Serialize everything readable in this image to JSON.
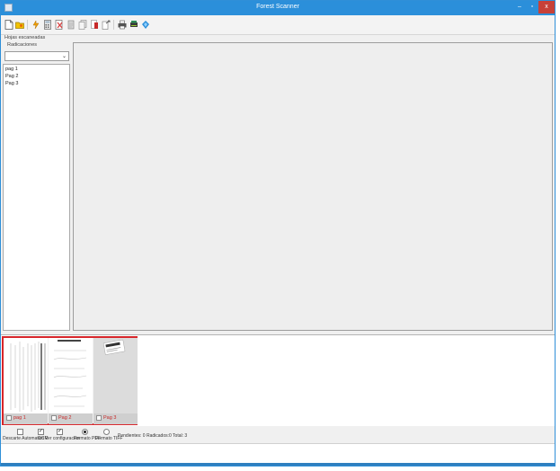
{
  "window": {
    "title": "Forest Scanner"
  },
  "titlebar": {
    "min": "–",
    "max": "▫",
    "close": "x"
  },
  "toolbar": {
    "items": [
      {
        "name": "new-document-icon",
        "color": "#ffffff"
      },
      {
        "name": "open-folder-icon",
        "color": "#e6b800"
      },
      {
        "name": "scan-icon",
        "color": "#f0a000"
      },
      {
        "name": "calculator-icon",
        "color": "#7a7a7a"
      },
      {
        "name": "delete-page-icon",
        "color": "#d83a3a"
      },
      {
        "name": "document-gray-icon",
        "color": "#8d8d8d"
      },
      {
        "name": "document-stack-icon",
        "color": "#9a9a9a"
      },
      {
        "name": "document-red-icon",
        "color": "#c62828"
      },
      {
        "name": "document-export-icon",
        "color": "#7a7a7a"
      },
      {
        "name": "printer-icon",
        "color": "#555555"
      },
      {
        "name": "scanner-green-icon",
        "color": "#2e8b57"
      },
      {
        "name": "help-icon",
        "color": "#2b8fda"
      }
    ]
  },
  "left_panel": {
    "caption": "Hojas escaneadas",
    "dropdown_caption": "Radicaciones",
    "dropdown_value": "",
    "pages": [
      "pag 1",
      "Pag 2",
      "Pag 3"
    ]
  },
  "thumbnails": [
    {
      "label": "pag 1"
    },
    {
      "label": "Pag 2"
    },
    {
      "label": "Pag 3"
    }
  ],
  "options": [
    {
      "label": "Descarte Automatico",
      "kind": "checkbox",
      "checked": false
    },
    {
      "label": "OCR",
      "kind": "checkbox",
      "checked": true
    },
    {
      "label": "Ver configuración",
      "kind": "checkbox",
      "checked": true
    },
    {
      "label": "Formato PDF",
      "kind": "radio",
      "checked": true
    },
    {
      "label": "Formato TIFF",
      "kind": "radio",
      "checked": false
    }
  ],
  "status": "Pendientes: 0 Radicados:0 Total: 3",
  "colors": {
    "accent": "#2b8fda",
    "close": "#c74138",
    "selection": "#d7262b"
  }
}
